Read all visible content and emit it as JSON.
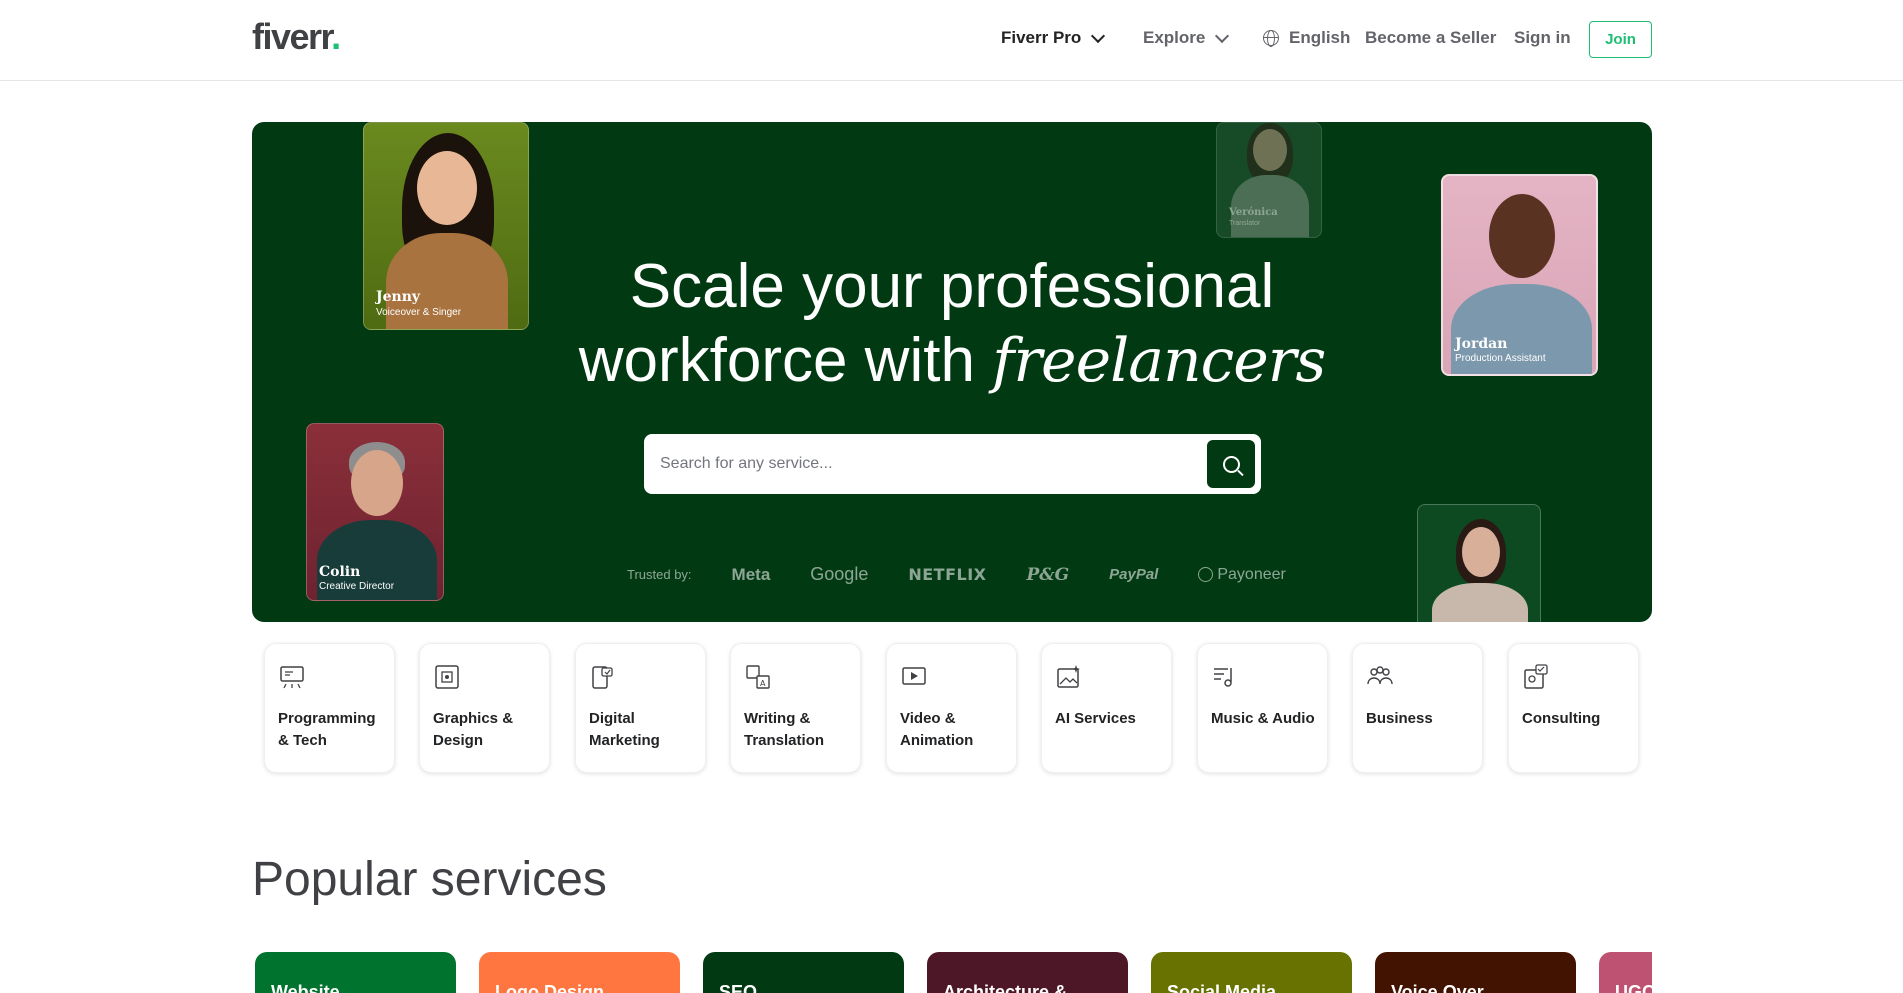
{
  "header": {
    "logo": "fiverr",
    "logo_dot": ".",
    "nav": {
      "fiverr_pro": "Fiverr Pro",
      "explore": "Explore",
      "language": "English",
      "become_seller": "Become a Seller",
      "sign_in": "Sign in",
      "join": "Join"
    }
  },
  "hero": {
    "title_line1": "Scale your professional",
    "title_line2_prefix": "workforce with ",
    "title_emphasis": "freelancers",
    "search": {
      "placeholder": "Search for any service..."
    },
    "trusted_label": "Trusted by:",
    "brands": [
      "Meta",
      "Google",
      "NETFLIX",
      "P&G",
      "PayPal",
      "Payoneer"
    ],
    "people": [
      {
        "name": "Jenny",
        "role": "Voiceover & Singer"
      },
      {
        "name": "Colin",
        "role": "Creative Director"
      },
      {
        "name": "Verónica",
        "role": "Translator"
      },
      {
        "name": "Jordan",
        "role": "Production Assistant"
      }
    ]
  },
  "categories": [
    {
      "label": "Programming & Tech",
      "icon": "monitor-code-icon"
    },
    {
      "label": "Graphics & Design",
      "icon": "design-frame-icon"
    },
    {
      "label": "Digital Marketing",
      "icon": "marketing-phone-icon"
    },
    {
      "label": "Writing & Translation",
      "icon": "translation-icon"
    },
    {
      "label": "Video & Animation",
      "icon": "video-play-icon"
    },
    {
      "label": "AI Services",
      "icon": "ai-image-icon"
    },
    {
      "label": "Music & Audio",
      "icon": "music-note-icon"
    },
    {
      "label": "Business",
      "icon": "people-group-icon"
    },
    {
      "label": "Consulting",
      "icon": "consulting-chat-icon"
    }
  ],
  "popular": {
    "title": "Popular services",
    "services": [
      {
        "label": "Website",
        "color": "#00732e"
      },
      {
        "label": "Logo Design",
        "color": "#ff7640"
      },
      {
        "label": "SEO",
        "color": "#003912"
      },
      {
        "label": "Architecture &",
        "color": "#4d1727"
      },
      {
        "label": "Social Media",
        "color": "#687200"
      },
      {
        "label": "Voice Over",
        "color": "#421300"
      },
      {
        "label": "UGC",
        "color": "#be5272"
      }
    ]
  },
  "colors": {
    "brand_green": "#1dbf73",
    "hero_bg": "#013912",
    "text_dark": "#404145"
  }
}
